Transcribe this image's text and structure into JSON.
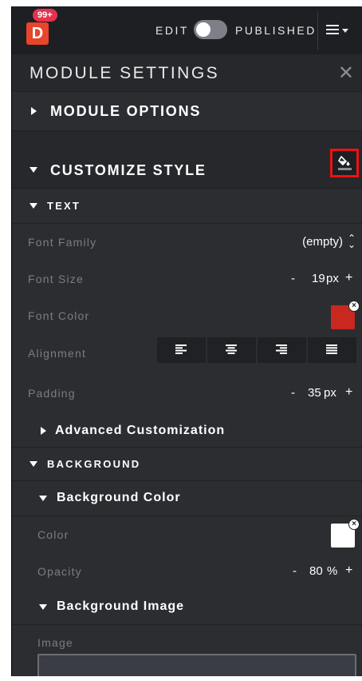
{
  "topbar": {
    "logo_letter": "D",
    "notification_badge": "99+",
    "mode_edit": "EDIT",
    "mode_published": "PUBLISHED",
    "toggle_on": false
  },
  "panel": {
    "title": "MODULE SETTINGS",
    "close_glyph": "✕"
  },
  "sections": {
    "module_options": "MODULE OPTIONS",
    "customize_style": "CUSTOMIZE STYLE",
    "text": "TEXT",
    "advanced_customization": "Advanced Customization",
    "background": "BACKGROUND",
    "background_color": "Background Color",
    "background_image": "Background Image"
  },
  "text_fields": {
    "font_family": {
      "label": "Font Family",
      "value": "(empty)",
      "arrows": "⌃⌄"
    },
    "font_size": {
      "label": "Font Size",
      "minus": "-",
      "value": "19",
      "unit": "px",
      "plus": "+"
    },
    "font_color": {
      "label": "Font Color",
      "color": "#c8281f"
    },
    "alignment": {
      "label": "Alignment",
      "options": [
        "align-left",
        "align-center",
        "align-right",
        "align-justify"
      ]
    },
    "padding": {
      "label": "Padding",
      "minus": "-",
      "value": "35",
      "unit": "px",
      "plus": "+"
    }
  },
  "background_fields": {
    "color": {
      "label": "Color",
      "color": "#ffffff"
    },
    "opacity": {
      "label": "Opacity",
      "minus": "-",
      "value": "80",
      "unit": "%",
      "plus": "+"
    },
    "image": {
      "label": "Image"
    }
  },
  "colors": {
    "panel_bg": "#2b2d31",
    "topbar_bg": "#1e1f22",
    "accent_red": "#e8452c",
    "badge": "#e5334f",
    "highlight_box": "#ee1111"
  },
  "icons": {
    "paint_bucket": "paint-bucket-icon",
    "menu": "hamburger-menu-icon",
    "remove": "remove-color-icon"
  }
}
